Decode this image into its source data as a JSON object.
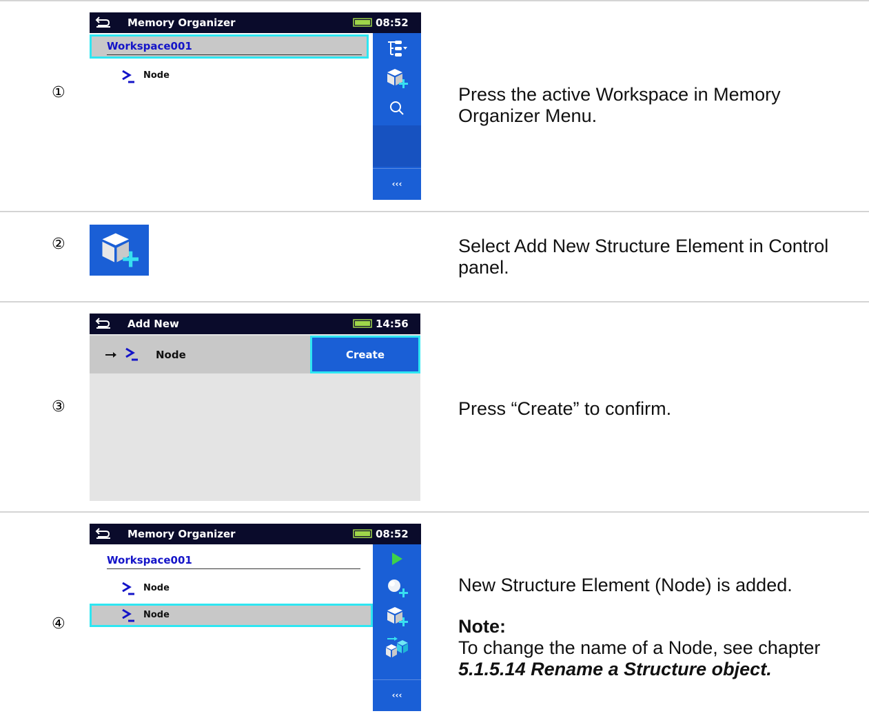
{
  "steps": [
    {
      "marker": "①",
      "description": "Press the active Workspace in Memory Organizer Menu."
    },
    {
      "marker": "②",
      "description": "Select Add New Structure Element in Control panel."
    },
    {
      "marker": "③",
      "description": "Press “Create” to confirm."
    },
    {
      "marker": "④",
      "description": "New Structure Element (Node) is added.",
      "note_label": "Note:",
      "note_text": "To change the name of a Node, see chapter",
      "note_reference": "5.1.5.14 Rename a Structure object."
    }
  ],
  "screen1": {
    "title": "Memory Organizer",
    "time": "08:52",
    "workspace": "Workspace001",
    "node": "Node",
    "panel_icons": [
      "tree-view-icon",
      "add-structure-icon",
      "search-icon",
      "empty",
      "more-icon"
    ],
    "more_label": "‹‹‹"
  },
  "screen3": {
    "title": "Add New",
    "time": "14:56",
    "node": "Node",
    "create_label": "Create"
  },
  "screen4": {
    "title": "Memory Organizer",
    "time": "08:52",
    "workspace": "Workspace001",
    "nodes": [
      "Node",
      "Node"
    ],
    "panel_icons": [
      "play-icon",
      "add-measurement-icon",
      "add-structure-icon",
      "copy-structure-icon",
      "more-icon"
    ],
    "more_label": "‹‹‹"
  },
  "colors": {
    "header": "#0a0b2b",
    "panel": "#1a5fd6",
    "highlight": "#2ee6f2",
    "selected_row": "#c8c8c8",
    "link": "#1414c8"
  }
}
